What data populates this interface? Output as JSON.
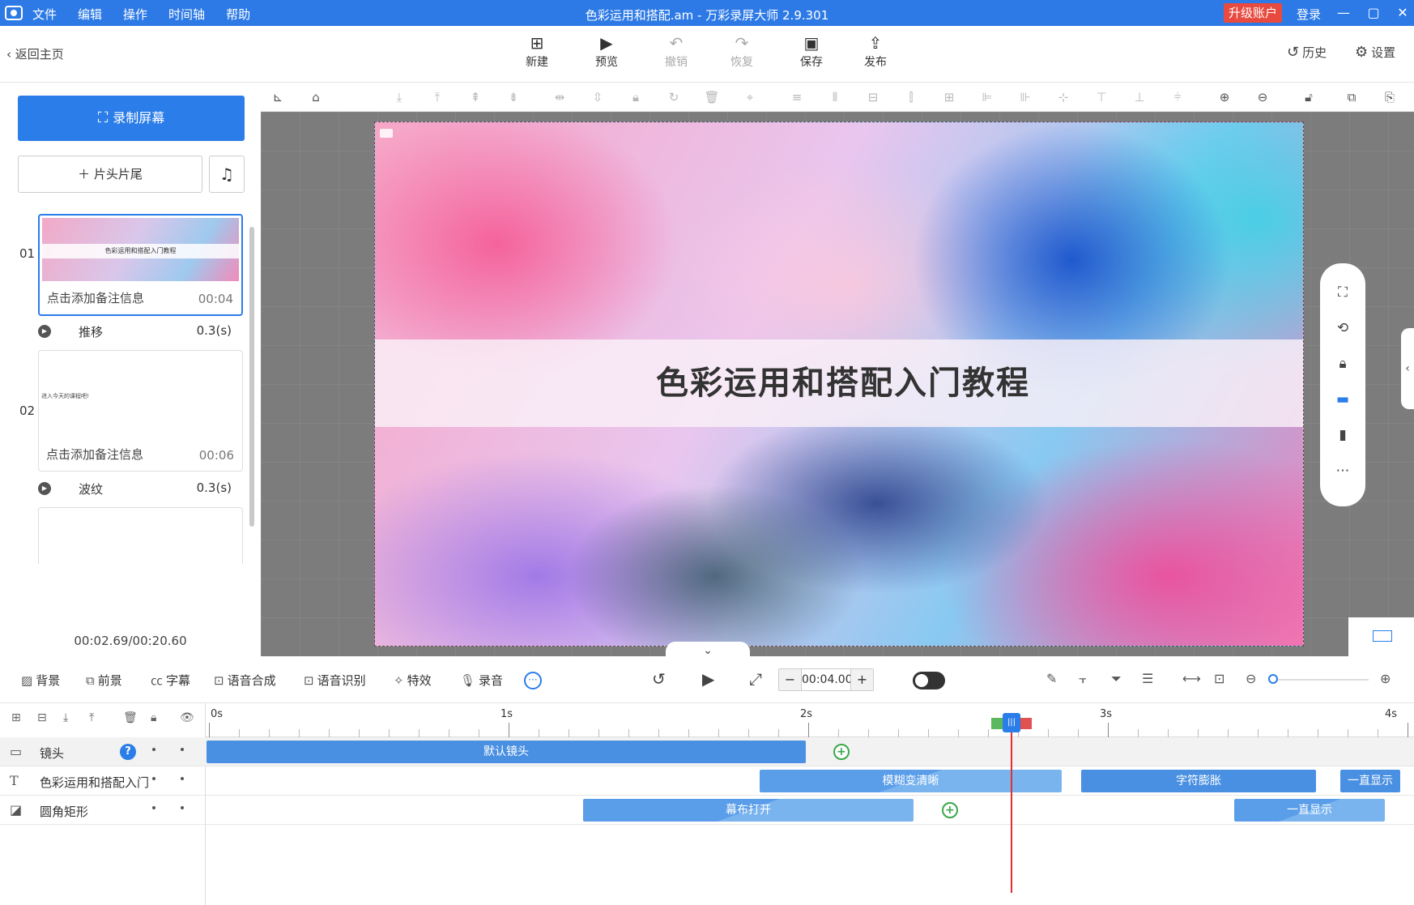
{
  "app": {
    "window_title": "色彩运用和搭配.am - 万彩录屏大师 2.9.301",
    "menu": [
      "文件",
      "编辑",
      "操作",
      "时间轴",
      "帮助"
    ],
    "upgrade": "升级账户",
    "login": "登录"
  },
  "toolbar": {
    "back": "返回主页",
    "buttons": [
      {
        "label": "新建",
        "icon": "plus-square-icon",
        "enabled": true
      },
      {
        "label": "预览",
        "icon": "play-icon",
        "enabled": true
      },
      {
        "label": "撤销",
        "icon": "undo-icon",
        "enabled": false
      },
      {
        "label": "恢复",
        "icon": "redo-icon",
        "enabled": false
      },
      {
        "label": "保存",
        "icon": "save-icon",
        "enabled": true
      },
      {
        "label": "发布",
        "icon": "publish-icon",
        "enabled": true
      }
    ],
    "history": "历史",
    "settings": "设置"
  },
  "left": {
    "record": "录制屏幕",
    "title_tail": "片头片尾",
    "slides": [
      {
        "num": "01",
        "note": "点击添加备注信息",
        "duration": "00:04",
        "thumb_title": "色彩运用和搭配入门教程"
      },
      {
        "num": "02",
        "note": "点击添加备注信息",
        "duration": "00:06",
        "thumb_title": "进入今天的课程吧!"
      }
    ],
    "transitions": [
      {
        "name": "推移",
        "time": "0.3(s)"
      },
      {
        "name": "波纹",
        "time": "0.3(s)"
      }
    ],
    "timecode": "00:02.69/00:20.60"
  },
  "stage": {
    "banner_title": "色彩运用和搭配入门教程"
  },
  "timeline_toolbar": {
    "items": [
      "背景",
      "前景",
      "字幕",
      "语音合成",
      "语音识别",
      "特效",
      "录音"
    ],
    "time": "00:04.00"
  },
  "timeline": {
    "ruler": [
      "0s",
      "1s",
      "2s",
      "3s",
      "4s"
    ],
    "tracks": [
      {
        "name": "镜头",
        "clips": [
          "默认镜头"
        ]
      },
      {
        "name": "色彩运用和搭配入门教程",
        "clips": [
          "模糊变清晰",
          "字符膨胀",
          "一直显示"
        ]
      },
      {
        "name": "圆角矩形",
        "clips": [
          "幕布打开",
          "一直显示"
        ]
      }
    ]
  },
  "colors": {
    "brand": "#2d7ae6",
    "accent": "#2b7de9",
    "upgrade": "#e84a3f",
    "playhead": "#e03030",
    "keyframe": "#3aa84a"
  }
}
